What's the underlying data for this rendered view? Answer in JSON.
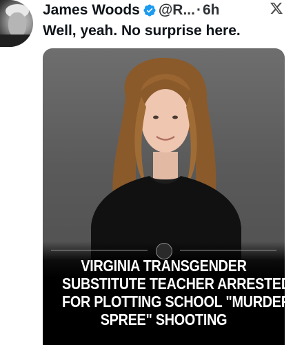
{
  "tweet": {
    "author_name": "James Woods",
    "handle": "@R...",
    "separator": "·",
    "time": "6h",
    "text": "Well, yeah. No surprise here."
  },
  "media": {
    "headline_lines": [
      "VIRGINIA TRANSGENDER",
      "SUBSTITUTE TEACHER ARRESTED",
      "FOR PLOTTING SCHOOL \"MURDER",
      "SPREE\" SHOOTING"
    ]
  },
  "icons": {
    "verified": "verified-badge-icon",
    "platform": "x-logo-icon"
  },
  "colors": {
    "text_primary": "#0f1419",
    "verified_blue": "#1d9bf0",
    "headline_text": "#ffffff"
  }
}
